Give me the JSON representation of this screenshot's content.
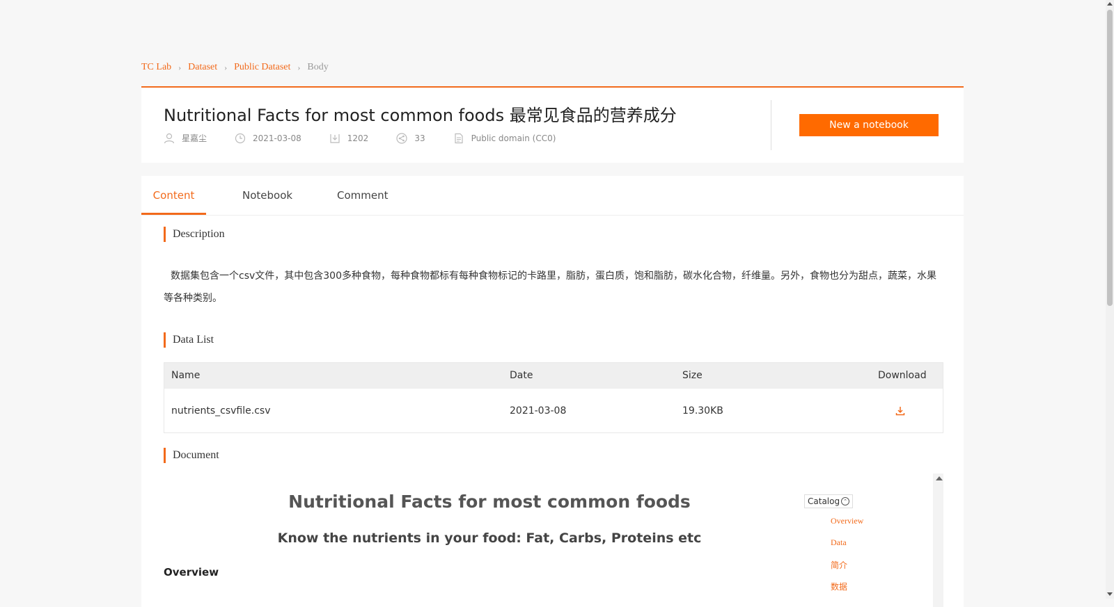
{
  "breadcrumb": {
    "items": [
      "TC Lab",
      "Dataset",
      "Public Dataset"
    ],
    "current": "Body"
  },
  "header": {
    "title": "Nutritional Facts for most common foods 最常见食品的营养成分",
    "author": "星嘉尘",
    "date": "2021-03-08",
    "downloads": "1202",
    "shares": "33",
    "license": "Public domain (CC0)",
    "new_notebook_label": "New a notebook"
  },
  "tabs": [
    {
      "label": "Content"
    },
    {
      "label": "Notebook"
    },
    {
      "label": "Comment"
    }
  ],
  "description": {
    "heading": "Description",
    "text": "数据集包含一个csv文件，其中包含300多种食物，每种食物都标有每种食物标记的卡路里，脂肪，蛋白质，饱和脂肪，碳水化合物，纤维量。另外，食物也分为甜点，蔬菜，水果等各种类别。"
  },
  "data_list": {
    "heading": "Data List",
    "columns": [
      "Name",
      "Date",
      "Size",
      "Download"
    ],
    "rows": [
      {
        "name": "nutrients_csvfile.csv",
        "date": "2021-03-08",
        "size": "19.30KB"
      }
    ]
  },
  "document": {
    "heading": "Document",
    "title": "Nutritional Facts for most common foods",
    "subtitle": "Know the nutrients in your food: Fat, Carbs, Proteins etc",
    "overview": "Overview",
    "catalog_label": "Catalog",
    "catalog_items": [
      "Overview",
      "Data",
      "简介",
      "数据"
    ]
  },
  "colors": {
    "accent": "#f26a1b",
    "button": "#ff6a00"
  }
}
